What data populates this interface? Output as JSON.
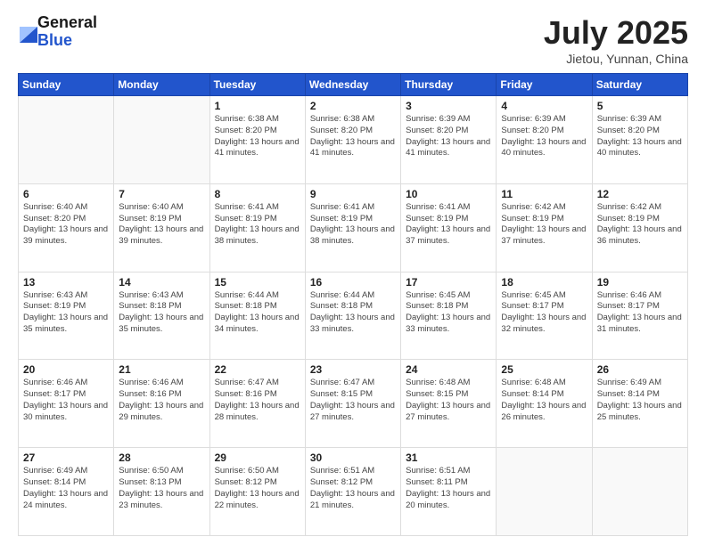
{
  "logo": {
    "general": "General",
    "blue": "Blue"
  },
  "header": {
    "month": "July 2025",
    "location": "Jietou, Yunnan, China"
  },
  "weekdays": [
    "Sunday",
    "Monday",
    "Tuesday",
    "Wednesday",
    "Thursday",
    "Friday",
    "Saturday"
  ],
  "weeks": [
    [
      {
        "day": "",
        "info": ""
      },
      {
        "day": "",
        "info": ""
      },
      {
        "day": "1",
        "info": "Sunrise: 6:38 AM\nSunset: 8:20 PM\nDaylight: 13 hours and 41 minutes."
      },
      {
        "day": "2",
        "info": "Sunrise: 6:38 AM\nSunset: 8:20 PM\nDaylight: 13 hours and 41 minutes."
      },
      {
        "day": "3",
        "info": "Sunrise: 6:39 AM\nSunset: 8:20 PM\nDaylight: 13 hours and 41 minutes."
      },
      {
        "day": "4",
        "info": "Sunrise: 6:39 AM\nSunset: 8:20 PM\nDaylight: 13 hours and 40 minutes."
      },
      {
        "day": "5",
        "info": "Sunrise: 6:39 AM\nSunset: 8:20 PM\nDaylight: 13 hours and 40 minutes."
      }
    ],
    [
      {
        "day": "6",
        "info": "Sunrise: 6:40 AM\nSunset: 8:20 PM\nDaylight: 13 hours and 39 minutes."
      },
      {
        "day": "7",
        "info": "Sunrise: 6:40 AM\nSunset: 8:19 PM\nDaylight: 13 hours and 39 minutes."
      },
      {
        "day": "8",
        "info": "Sunrise: 6:41 AM\nSunset: 8:19 PM\nDaylight: 13 hours and 38 minutes."
      },
      {
        "day": "9",
        "info": "Sunrise: 6:41 AM\nSunset: 8:19 PM\nDaylight: 13 hours and 38 minutes."
      },
      {
        "day": "10",
        "info": "Sunrise: 6:41 AM\nSunset: 8:19 PM\nDaylight: 13 hours and 37 minutes."
      },
      {
        "day": "11",
        "info": "Sunrise: 6:42 AM\nSunset: 8:19 PM\nDaylight: 13 hours and 37 minutes."
      },
      {
        "day": "12",
        "info": "Sunrise: 6:42 AM\nSunset: 8:19 PM\nDaylight: 13 hours and 36 minutes."
      }
    ],
    [
      {
        "day": "13",
        "info": "Sunrise: 6:43 AM\nSunset: 8:19 PM\nDaylight: 13 hours and 35 minutes."
      },
      {
        "day": "14",
        "info": "Sunrise: 6:43 AM\nSunset: 8:18 PM\nDaylight: 13 hours and 35 minutes."
      },
      {
        "day": "15",
        "info": "Sunrise: 6:44 AM\nSunset: 8:18 PM\nDaylight: 13 hours and 34 minutes."
      },
      {
        "day": "16",
        "info": "Sunrise: 6:44 AM\nSunset: 8:18 PM\nDaylight: 13 hours and 33 minutes."
      },
      {
        "day": "17",
        "info": "Sunrise: 6:45 AM\nSunset: 8:18 PM\nDaylight: 13 hours and 33 minutes."
      },
      {
        "day": "18",
        "info": "Sunrise: 6:45 AM\nSunset: 8:17 PM\nDaylight: 13 hours and 32 minutes."
      },
      {
        "day": "19",
        "info": "Sunrise: 6:46 AM\nSunset: 8:17 PM\nDaylight: 13 hours and 31 minutes."
      }
    ],
    [
      {
        "day": "20",
        "info": "Sunrise: 6:46 AM\nSunset: 8:17 PM\nDaylight: 13 hours and 30 minutes."
      },
      {
        "day": "21",
        "info": "Sunrise: 6:46 AM\nSunset: 8:16 PM\nDaylight: 13 hours and 29 minutes."
      },
      {
        "day": "22",
        "info": "Sunrise: 6:47 AM\nSunset: 8:16 PM\nDaylight: 13 hours and 28 minutes."
      },
      {
        "day": "23",
        "info": "Sunrise: 6:47 AM\nSunset: 8:15 PM\nDaylight: 13 hours and 27 minutes."
      },
      {
        "day": "24",
        "info": "Sunrise: 6:48 AM\nSunset: 8:15 PM\nDaylight: 13 hours and 27 minutes."
      },
      {
        "day": "25",
        "info": "Sunrise: 6:48 AM\nSunset: 8:14 PM\nDaylight: 13 hours and 26 minutes."
      },
      {
        "day": "26",
        "info": "Sunrise: 6:49 AM\nSunset: 8:14 PM\nDaylight: 13 hours and 25 minutes."
      }
    ],
    [
      {
        "day": "27",
        "info": "Sunrise: 6:49 AM\nSunset: 8:14 PM\nDaylight: 13 hours and 24 minutes."
      },
      {
        "day": "28",
        "info": "Sunrise: 6:50 AM\nSunset: 8:13 PM\nDaylight: 13 hours and 23 minutes."
      },
      {
        "day": "29",
        "info": "Sunrise: 6:50 AM\nSunset: 8:12 PM\nDaylight: 13 hours and 22 minutes."
      },
      {
        "day": "30",
        "info": "Sunrise: 6:51 AM\nSunset: 8:12 PM\nDaylight: 13 hours and 21 minutes."
      },
      {
        "day": "31",
        "info": "Sunrise: 6:51 AM\nSunset: 8:11 PM\nDaylight: 13 hours and 20 minutes."
      },
      {
        "day": "",
        "info": ""
      },
      {
        "day": "",
        "info": ""
      }
    ]
  ]
}
